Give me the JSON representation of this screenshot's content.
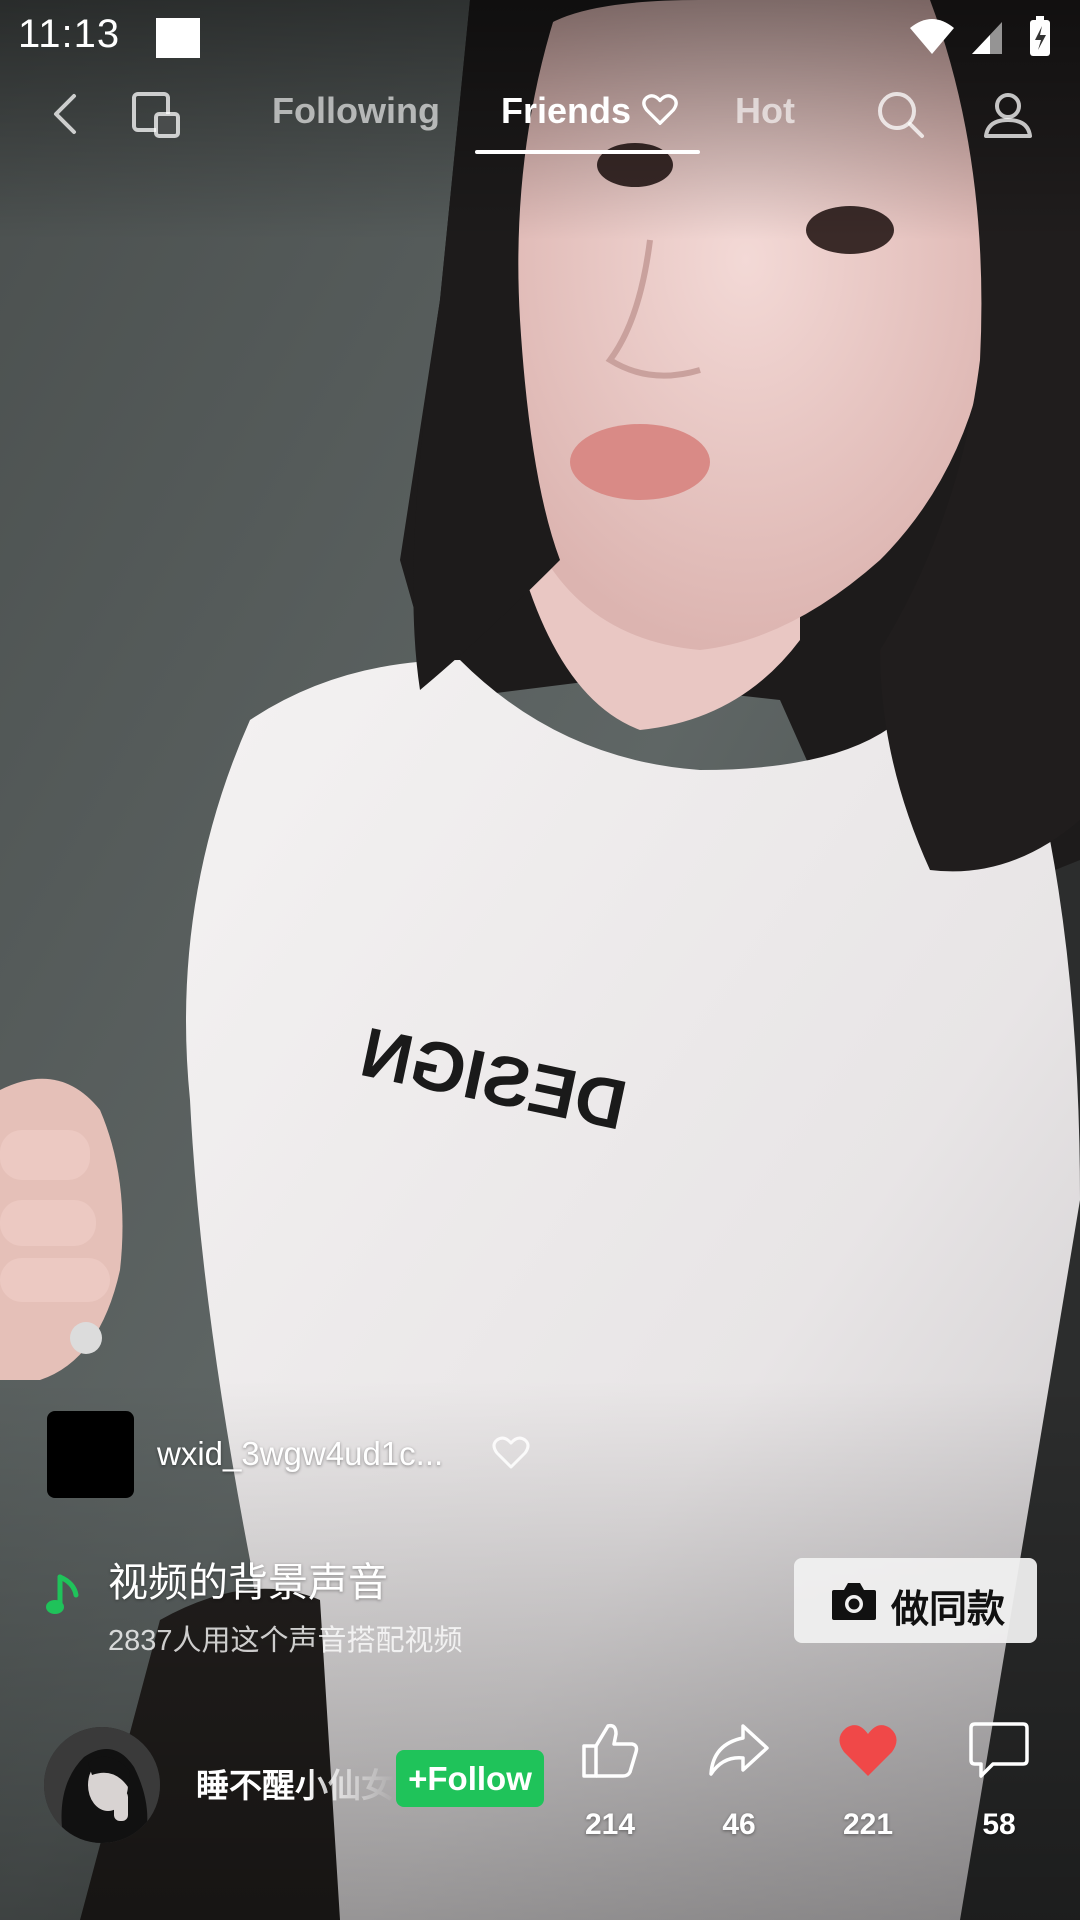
{
  "status_bar": {
    "time": "11:13"
  },
  "top_nav": {
    "tabs": [
      {
        "label": "Following",
        "active": false
      },
      {
        "label": "Friends",
        "active": true
      },
      {
        "label": "Hot",
        "active": false
      }
    ],
    "icons": [
      "back-icon",
      "screen-cast-icon",
      "search-icon",
      "profile-icon"
    ]
  },
  "author": {
    "name": "wxid_3wgw4ud1c..."
  },
  "music": {
    "title": "视频的背景声音",
    "usage": "2837人用这个声音搭配视频",
    "make_same_label": "做同款"
  },
  "poster": {
    "name": "睡不醒小仙女",
    "follow_label": "+Follow"
  },
  "actions": {
    "likes": "214",
    "shares": "46",
    "favorites": "221",
    "comments": "58"
  },
  "colors": {
    "accent_green": "#1fc35a",
    "favorite_red": "#f04848",
    "follow_button": "#1fc35a"
  }
}
